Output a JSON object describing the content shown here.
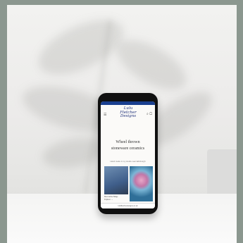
{
  "status_bar": {
    "left": "",
    "right": ""
  },
  "site": {
    "logo_lines": [
      "Lulu",
      "Fletcher",
      "Designs"
    ],
    "headline_lines": [
      "Wheel thrown",
      "stoneware ceramics"
    ],
    "subtitle": "Hand made in my studio near Edinburgh",
    "card_caption_lines": [
      "Decorative Mugs",
      "Explore →"
    ],
    "url_bar": "luluflletcherdesigns.co.uk"
  },
  "icons": {
    "menu": "menu-icon",
    "search": "search-icon",
    "cart": "cart-icon"
  },
  "colors": {
    "brand": "#1d2f7a",
    "status_bar": "#1a3f8f"
  }
}
